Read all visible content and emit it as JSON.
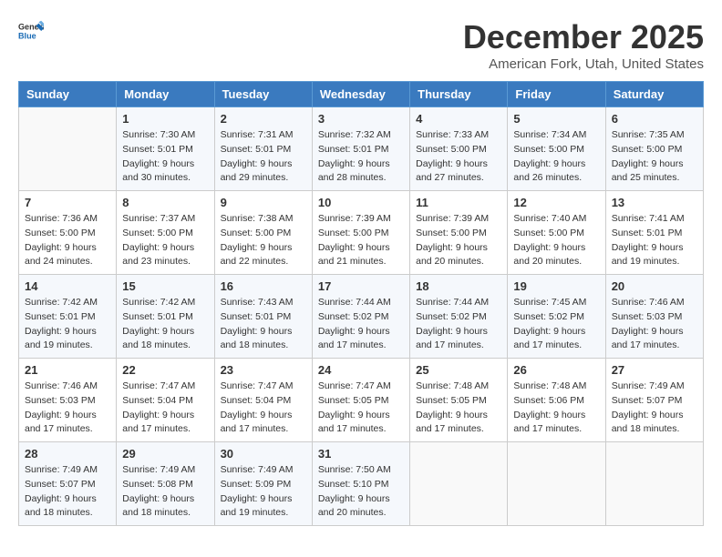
{
  "logo": {
    "text_general": "General",
    "text_blue": "Blue"
  },
  "title": "December 2025",
  "subtitle": "American Fork, Utah, United States",
  "weekdays": [
    "Sunday",
    "Monday",
    "Tuesday",
    "Wednesday",
    "Thursday",
    "Friday",
    "Saturday"
  ],
  "weeks": [
    [
      {
        "day": "",
        "info": ""
      },
      {
        "day": "1",
        "info": "Sunrise: 7:30 AM\nSunset: 5:01 PM\nDaylight: 9 hours\nand 30 minutes."
      },
      {
        "day": "2",
        "info": "Sunrise: 7:31 AM\nSunset: 5:01 PM\nDaylight: 9 hours\nand 29 minutes."
      },
      {
        "day": "3",
        "info": "Sunrise: 7:32 AM\nSunset: 5:01 PM\nDaylight: 9 hours\nand 28 minutes."
      },
      {
        "day": "4",
        "info": "Sunrise: 7:33 AM\nSunset: 5:00 PM\nDaylight: 9 hours\nand 27 minutes."
      },
      {
        "day": "5",
        "info": "Sunrise: 7:34 AM\nSunset: 5:00 PM\nDaylight: 9 hours\nand 26 minutes."
      },
      {
        "day": "6",
        "info": "Sunrise: 7:35 AM\nSunset: 5:00 PM\nDaylight: 9 hours\nand 25 minutes."
      }
    ],
    [
      {
        "day": "7",
        "info": "Sunrise: 7:36 AM\nSunset: 5:00 PM\nDaylight: 9 hours\nand 24 minutes."
      },
      {
        "day": "8",
        "info": "Sunrise: 7:37 AM\nSunset: 5:00 PM\nDaylight: 9 hours\nand 23 minutes."
      },
      {
        "day": "9",
        "info": "Sunrise: 7:38 AM\nSunset: 5:00 PM\nDaylight: 9 hours\nand 22 minutes."
      },
      {
        "day": "10",
        "info": "Sunrise: 7:39 AM\nSunset: 5:00 PM\nDaylight: 9 hours\nand 21 minutes."
      },
      {
        "day": "11",
        "info": "Sunrise: 7:39 AM\nSunset: 5:00 PM\nDaylight: 9 hours\nand 20 minutes."
      },
      {
        "day": "12",
        "info": "Sunrise: 7:40 AM\nSunset: 5:00 PM\nDaylight: 9 hours\nand 20 minutes."
      },
      {
        "day": "13",
        "info": "Sunrise: 7:41 AM\nSunset: 5:01 PM\nDaylight: 9 hours\nand 19 minutes."
      }
    ],
    [
      {
        "day": "14",
        "info": "Sunrise: 7:42 AM\nSunset: 5:01 PM\nDaylight: 9 hours\nand 19 minutes."
      },
      {
        "day": "15",
        "info": "Sunrise: 7:42 AM\nSunset: 5:01 PM\nDaylight: 9 hours\nand 18 minutes."
      },
      {
        "day": "16",
        "info": "Sunrise: 7:43 AM\nSunset: 5:01 PM\nDaylight: 9 hours\nand 18 minutes."
      },
      {
        "day": "17",
        "info": "Sunrise: 7:44 AM\nSunset: 5:02 PM\nDaylight: 9 hours\nand 17 minutes."
      },
      {
        "day": "18",
        "info": "Sunrise: 7:44 AM\nSunset: 5:02 PM\nDaylight: 9 hours\nand 17 minutes."
      },
      {
        "day": "19",
        "info": "Sunrise: 7:45 AM\nSunset: 5:02 PM\nDaylight: 9 hours\nand 17 minutes."
      },
      {
        "day": "20",
        "info": "Sunrise: 7:46 AM\nSunset: 5:03 PM\nDaylight: 9 hours\nand 17 minutes."
      }
    ],
    [
      {
        "day": "21",
        "info": "Sunrise: 7:46 AM\nSunset: 5:03 PM\nDaylight: 9 hours\nand 17 minutes."
      },
      {
        "day": "22",
        "info": "Sunrise: 7:47 AM\nSunset: 5:04 PM\nDaylight: 9 hours\nand 17 minutes."
      },
      {
        "day": "23",
        "info": "Sunrise: 7:47 AM\nSunset: 5:04 PM\nDaylight: 9 hours\nand 17 minutes."
      },
      {
        "day": "24",
        "info": "Sunrise: 7:47 AM\nSunset: 5:05 PM\nDaylight: 9 hours\nand 17 minutes."
      },
      {
        "day": "25",
        "info": "Sunrise: 7:48 AM\nSunset: 5:05 PM\nDaylight: 9 hours\nand 17 minutes."
      },
      {
        "day": "26",
        "info": "Sunrise: 7:48 AM\nSunset: 5:06 PM\nDaylight: 9 hours\nand 17 minutes."
      },
      {
        "day": "27",
        "info": "Sunrise: 7:49 AM\nSunset: 5:07 PM\nDaylight: 9 hours\nand 18 minutes."
      }
    ],
    [
      {
        "day": "28",
        "info": "Sunrise: 7:49 AM\nSunset: 5:07 PM\nDaylight: 9 hours\nand 18 minutes."
      },
      {
        "day": "29",
        "info": "Sunrise: 7:49 AM\nSunset: 5:08 PM\nDaylight: 9 hours\nand 18 minutes."
      },
      {
        "day": "30",
        "info": "Sunrise: 7:49 AM\nSunset: 5:09 PM\nDaylight: 9 hours\nand 19 minutes."
      },
      {
        "day": "31",
        "info": "Sunrise: 7:50 AM\nSunset: 5:10 PM\nDaylight: 9 hours\nand 20 minutes."
      },
      {
        "day": "",
        "info": ""
      },
      {
        "day": "",
        "info": ""
      },
      {
        "day": "",
        "info": ""
      }
    ]
  ]
}
